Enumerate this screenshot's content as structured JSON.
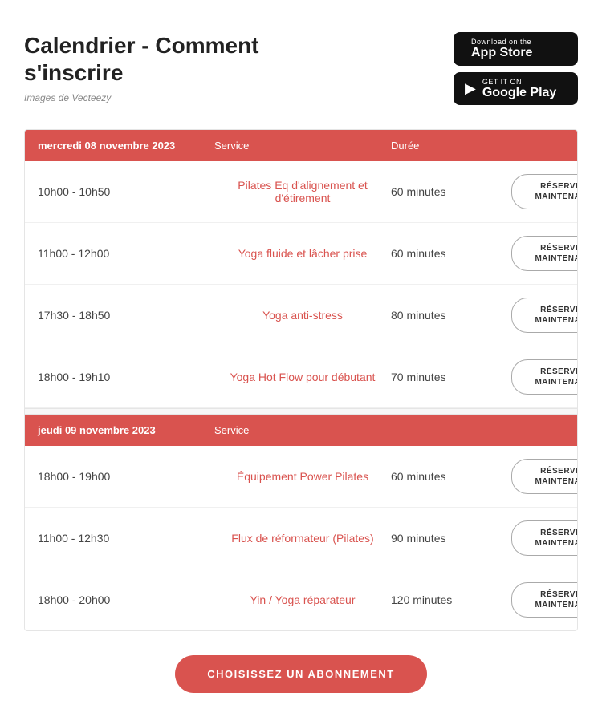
{
  "header": {
    "title_line1": "Calendrier - Comment",
    "title_line2": "s'inscrire",
    "image_credit": "Images de Vecteezy",
    "app_store": {
      "top": "Download on the",
      "bottom": "App Store",
      "icon": "🍎"
    },
    "google_play": {
      "top": "GET IT ON",
      "bottom": "Google Play",
      "icon": "▶"
    }
  },
  "sections": [
    {
      "id": "section-1",
      "date": "mercredi 08 novembre 2023",
      "col_service": "Service",
      "col_duree": "Durée",
      "rows": [
        {
          "time": "10h00 - 10h50",
          "service": "Pilates Eq d'alignement et d'étirement",
          "duration": "60 minutes",
          "btn": "RÉSERVEZ\nMAINTENANT"
        },
        {
          "time": "11h00 - 12h00",
          "service": "Yoga fluide et lâcher prise",
          "duration": "60 minutes",
          "btn": "RÉSERVEZ\nMAINTENANT"
        },
        {
          "time": "17h30 - 18h50",
          "service": "Yoga anti-stress",
          "duration": "80 minutes",
          "btn": "RÉSERVEZ\nMAINTENANT"
        },
        {
          "time": "18h00 - 19h10",
          "service": "Yoga Hot Flow pour débutant",
          "duration": "70 minutes",
          "btn": "RÉSERVEZ\nMAINTENANT"
        }
      ]
    },
    {
      "id": "section-2",
      "date": "jeudi 09 novembre 2023",
      "col_service": "Service",
      "col_duree": "",
      "rows": [
        {
          "time": "18h00 - 19h00",
          "service": "Équipement Power Pilates",
          "duration": "60 minutes",
          "btn": "RÉSERVEZ\nMAINTENANT"
        },
        {
          "time": "11h00 - 12h30",
          "service": "Flux de réformateur (Pilates)",
          "duration": "90 minutes",
          "btn": "RÉSERVEZ\nMAINTENANT"
        },
        {
          "time": "18h00 - 20h00",
          "service": "Yin / Yoga réparateur",
          "duration": "120 minutes",
          "btn": "RÉSERVEZ\nMAINTENANT"
        }
      ]
    }
  ],
  "cta_button": "CHOISISSEZ UN ABONNEMENT"
}
